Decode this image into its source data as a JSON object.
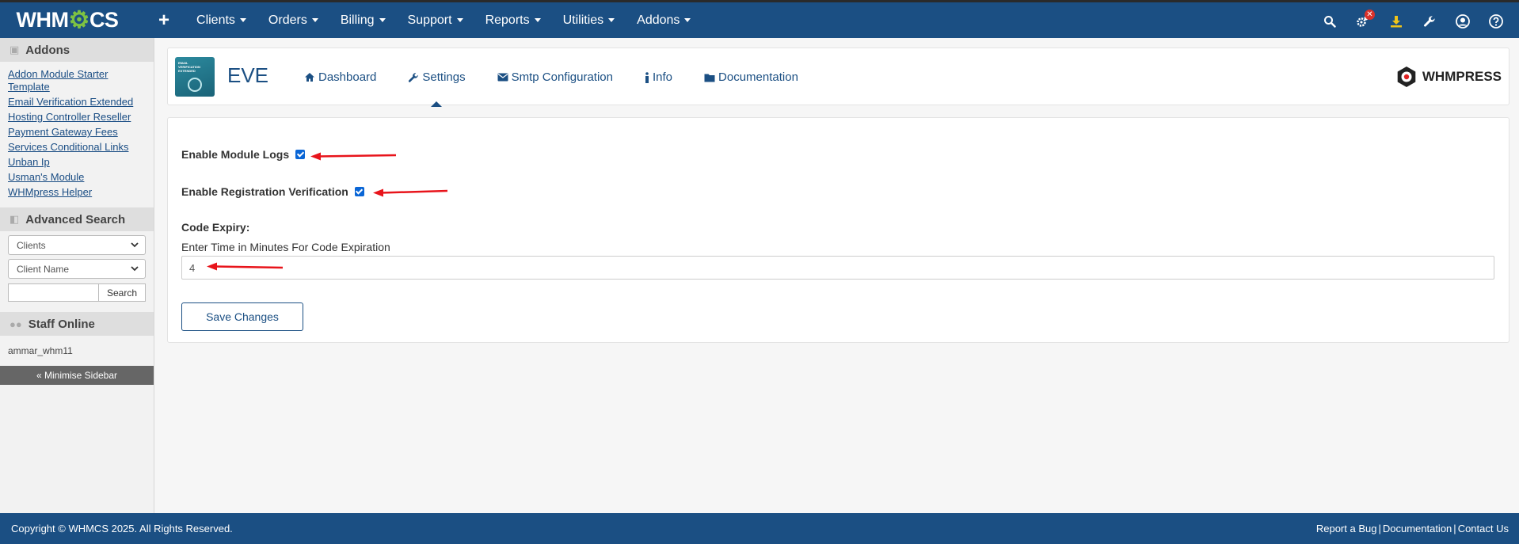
{
  "brand": {
    "logo_text_a": "WHM",
    "logo_text_b": "CS",
    "gear_glyph": "⚙"
  },
  "nav": {
    "plus": "+",
    "items": [
      "Clients",
      "Orders",
      "Billing",
      "Support",
      "Reports",
      "Utilities",
      "Addons"
    ],
    "badge": "✕"
  },
  "sidebar": {
    "addons_title": "Addons",
    "addons_links": [
      "Addon Module Starter Template",
      "Email Verification Extended",
      "Hosting Controller Reseller",
      "Payment Gateway Fees",
      "Services Conditional Links",
      "Unban Ip",
      "Usman's Module",
      "WHMpress Helper"
    ],
    "search_title": "Advanced Search",
    "search_type": "Clients",
    "search_field": "Client Name",
    "search_value": "",
    "search_button": "Search",
    "staff_title": "Staff Online",
    "staff_user": "ammar_whm11",
    "minimise": "« Minimise Sidebar"
  },
  "module": {
    "title": "EVE",
    "logo_caption": "EMAIL VERIFICATION EXTENDED",
    "tabs": [
      {
        "label": "Dashboard",
        "icon": "home-icon"
      },
      {
        "label": "Settings",
        "icon": "wrench-icon"
      },
      {
        "label": "Smtp Configuration",
        "icon": "envelope-icon"
      },
      {
        "label": "Info",
        "icon": "info-icon"
      },
      {
        "label": "Documentation",
        "icon": "folder-icon"
      }
    ],
    "active_tab": "Settings",
    "vendor": "WHMPRESS"
  },
  "settings": {
    "module_logs_label": "Enable Module Logs",
    "module_logs_checked": true,
    "registration_label": "Enable Registration Verification",
    "registration_checked": true,
    "code_expiry_label": "Code Expiry:",
    "code_expiry_help": "Enter Time in Minutes For Code Expiration",
    "code_expiry_value": "4",
    "save_button": "Save Changes"
  },
  "footer": {
    "copyright": "Copyright © WHMCS 2025. All Rights Reserved.",
    "links": [
      "Report a Bug",
      "Documentation",
      "Contact Us"
    ],
    "separator": "|"
  },
  "colors": {
    "nav_bg": "#1b4f83",
    "accent": "#1b4f83",
    "checkbox": "#0a66d6",
    "annotation_arrow": "#e8141b",
    "logo_gear": "#7dc242"
  }
}
